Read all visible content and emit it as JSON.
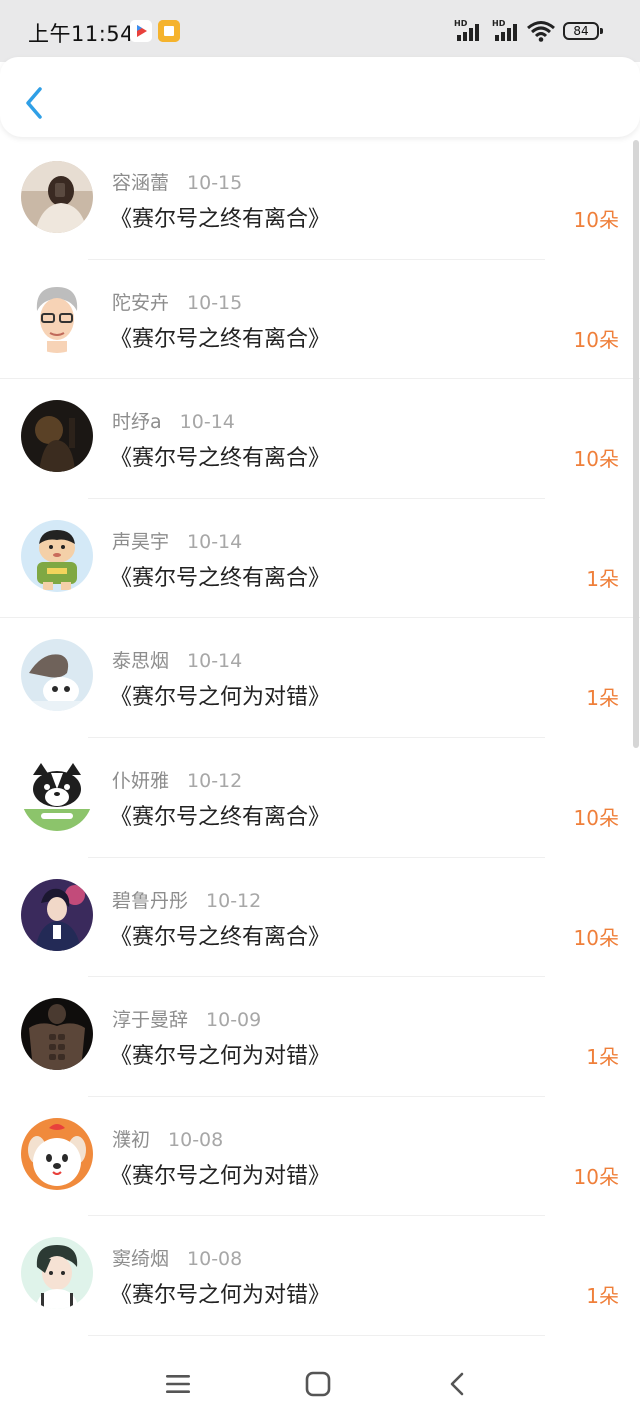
{
  "status_bar": {
    "time": "上午11:54",
    "battery": "84",
    "signal_label_1": "HD",
    "signal_label_2": "HD"
  },
  "header": {
    "back_icon": "chevron-left-icon"
  },
  "colors": {
    "accent": "#2f9fe6",
    "flower_count": "#ef7f3a"
  },
  "records": [
    {
      "user": "容涵蕾",
      "date": "10-15",
      "title": "《赛尔号之终有离合》",
      "count": "10朵",
      "avatar": "photo-woman-selfie"
    },
    {
      "user": "陀安卉",
      "date": "10-15",
      "title": "《赛尔号之终有离合》",
      "count": "10朵",
      "avatar": "cartoon-glasses-man"
    },
    {
      "user": "时纾a",
      "date": "10-14",
      "title": "《赛尔号之终有离合》",
      "count": "10朵",
      "avatar": "photo-dark-silhouette"
    },
    {
      "user": "声昊宇",
      "date": "10-14",
      "title": "《赛尔号之终有离合》",
      "count": "1朵",
      "avatar": "cartoon-boy-green"
    },
    {
      "user": "泰思烟",
      "date": "10-14",
      "title": "《赛尔号之何为对错》",
      "count": "1朵",
      "avatar": "photo-winter-pet"
    },
    {
      "user": "仆妍雅",
      "date": "10-12",
      "title": "《赛尔号之终有离合》",
      "count": "10朵",
      "avatar": "cartoon-husky"
    },
    {
      "user": "碧鲁丹彤",
      "date": "10-12",
      "title": "《赛尔号之终有离合》",
      "count": "10朵",
      "avatar": "anime-boy-purple"
    },
    {
      "user": "淳于曼辞",
      "date": "10-09",
      "title": "《赛尔号之何为对错》",
      "count": "1朵",
      "avatar": "photo-muscle-man"
    },
    {
      "user": "濮初",
      "date": "10-08",
      "title": "《赛尔号之何为对错》",
      "count": "10朵",
      "avatar": "cartoon-dog-orange"
    },
    {
      "user": "窦绮烟",
      "date": "10-08",
      "title": "《赛尔号之何为对错》",
      "count": "1朵",
      "avatar": "anime-boy-green"
    }
  ],
  "nav_bar": {
    "items": [
      "menu-icon",
      "home-icon",
      "back-icon"
    ]
  }
}
